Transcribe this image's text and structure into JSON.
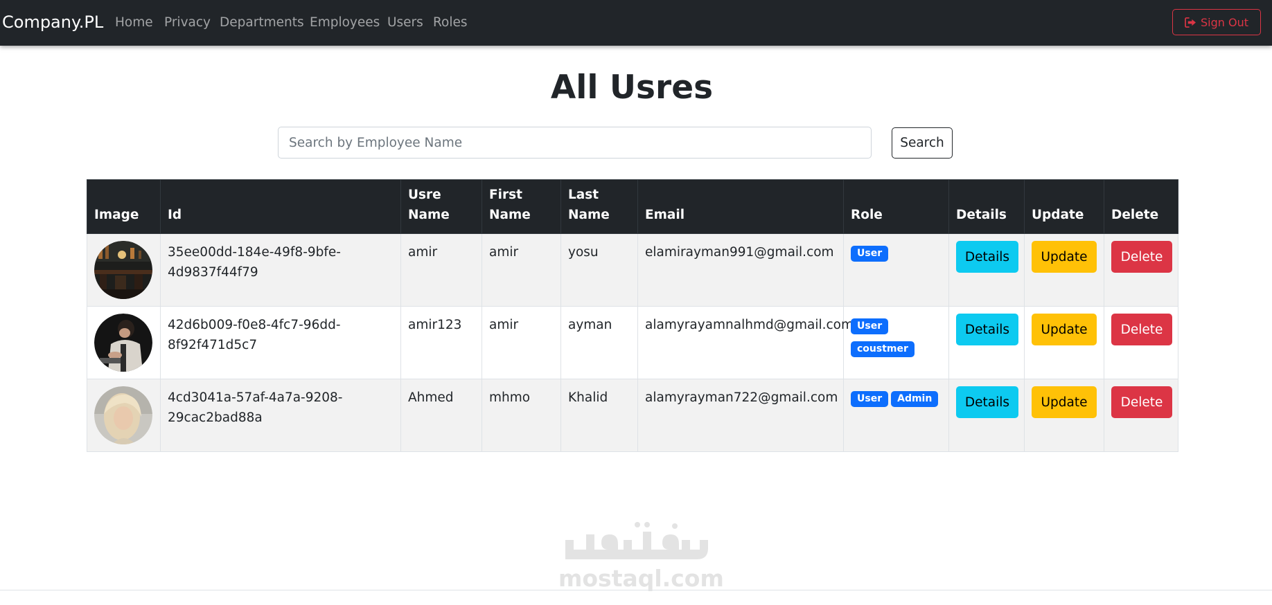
{
  "navbar": {
    "brand": "Company.PL",
    "links": [
      "Home",
      "Privacy",
      "Departments",
      "Employees",
      "Users",
      "Roles"
    ],
    "sign_out": "Sign Out"
  },
  "page_title": "All Usres",
  "search": {
    "placeholder": "Search by Employee Name",
    "value": "",
    "button": "Search"
  },
  "table": {
    "headers": {
      "image": "Image",
      "id": "Id",
      "username": "Usre Name",
      "first_name": "First Name",
      "last_name": "Last Name",
      "email": "Email",
      "role": "Role",
      "details": "Details",
      "update": "Update",
      "delete": "Delete"
    },
    "rows": [
      {
        "id": "35ee00dd-184e-49f8-9bfe-4d9837f44f79",
        "username": "amir",
        "first_name": "amir",
        "last_name": "yosu",
        "email": "elamirayman991@gmail.com",
        "roles": [
          "User"
        ],
        "details": "Details",
        "update": "Update",
        "delete": "Delete"
      },
      {
        "id": "42d6b009-f0e8-4fc7-96dd-8f92f471d5c7",
        "username": "amir123",
        "first_name": "amir",
        "last_name": "ayman",
        "email": "alamyrayamnalhmd@gmail.com",
        "roles": [
          "User",
          "coustmer"
        ],
        "details": "Details",
        "update": "Update",
        "delete": "Delete"
      },
      {
        "id": "4cd3041a-57af-4a7a-9208-29cac2bad88a",
        "username": "Ahmed",
        "first_name": "mhmo",
        "last_name": "Khalid",
        "email": "alamyrayman722@gmail.com",
        "roles": [
          "User",
          "Admin"
        ],
        "details": "Details",
        "update": "Update",
        "delete": "Delete"
      }
    ]
  },
  "watermark": {
    "logo_text": "مستقل",
    "site": "mostaql.com"
  },
  "colors": {
    "navbar": "#212529",
    "danger": "#dc3545",
    "info": "#0dcaf0",
    "warning": "#ffc107",
    "primary": "#0d6efd",
    "striped_row": "#f2f2f2"
  }
}
